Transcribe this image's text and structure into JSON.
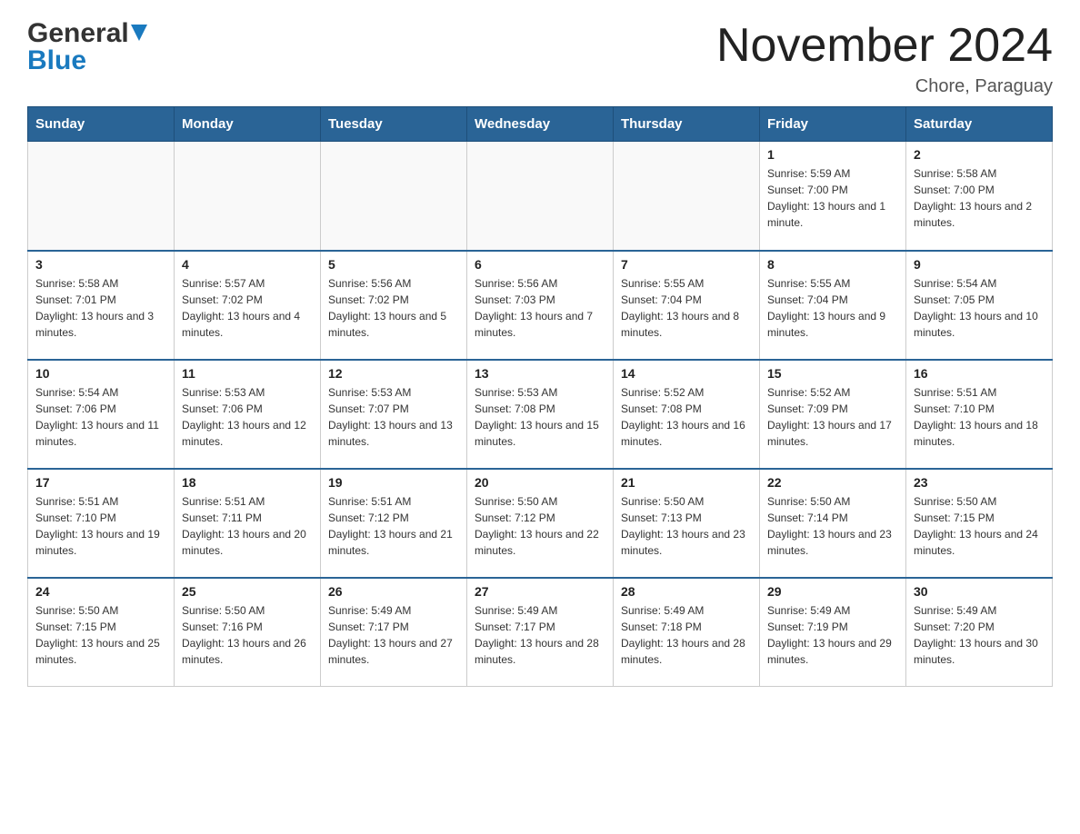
{
  "header": {
    "logo_general": "General",
    "logo_blue": "Blue",
    "month_title": "November 2024",
    "location": "Chore, Paraguay"
  },
  "days_of_week": [
    "Sunday",
    "Monday",
    "Tuesday",
    "Wednesday",
    "Thursday",
    "Friday",
    "Saturday"
  ],
  "weeks": [
    {
      "days": [
        {
          "number": "",
          "sunrise": "",
          "sunset": "",
          "daylight": ""
        },
        {
          "number": "",
          "sunrise": "",
          "sunset": "",
          "daylight": ""
        },
        {
          "number": "",
          "sunrise": "",
          "sunset": "",
          "daylight": ""
        },
        {
          "number": "",
          "sunrise": "",
          "sunset": "",
          "daylight": ""
        },
        {
          "number": "",
          "sunrise": "",
          "sunset": "",
          "daylight": ""
        },
        {
          "number": "1",
          "sunrise": "Sunrise: 5:59 AM",
          "sunset": "Sunset: 7:00 PM",
          "daylight": "Daylight: 13 hours and 1 minute."
        },
        {
          "number": "2",
          "sunrise": "Sunrise: 5:58 AM",
          "sunset": "Sunset: 7:00 PM",
          "daylight": "Daylight: 13 hours and 2 minutes."
        }
      ]
    },
    {
      "days": [
        {
          "number": "3",
          "sunrise": "Sunrise: 5:58 AM",
          "sunset": "Sunset: 7:01 PM",
          "daylight": "Daylight: 13 hours and 3 minutes."
        },
        {
          "number": "4",
          "sunrise": "Sunrise: 5:57 AM",
          "sunset": "Sunset: 7:02 PM",
          "daylight": "Daylight: 13 hours and 4 minutes."
        },
        {
          "number": "5",
          "sunrise": "Sunrise: 5:56 AM",
          "sunset": "Sunset: 7:02 PM",
          "daylight": "Daylight: 13 hours and 5 minutes."
        },
        {
          "number": "6",
          "sunrise": "Sunrise: 5:56 AM",
          "sunset": "Sunset: 7:03 PM",
          "daylight": "Daylight: 13 hours and 7 minutes."
        },
        {
          "number": "7",
          "sunrise": "Sunrise: 5:55 AM",
          "sunset": "Sunset: 7:04 PM",
          "daylight": "Daylight: 13 hours and 8 minutes."
        },
        {
          "number": "8",
          "sunrise": "Sunrise: 5:55 AM",
          "sunset": "Sunset: 7:04 PM",
          "daylight": "Daylight: 13 hours and 9 minutes."
        },
        {
          "number": "9",
          "sunrise": "Sunrise: 5:54 AM",
          "sunset": "Sunset: 7:05 PM",
          "daylight": "Daylight: 13 hours and 10 minutes."
        }
      ]
    },
    {
      "days": [
        {
          "number": "10",
          "sunrise": "Sunrise: 5:54 AM",
          "sunset": "Sunset: 7:06 PM",
          "daylight": "Daylight: 13 hours and 11 minutes."
        },
        {
          "number": "11",
          "sunrise": "Sunrise: 5:53 AM",
          "sunset": "Sunset: 7:06 PM",
          "daylight": "Daylight: 13 hours and 12 minutes."
        },
        {
          "number": "12",
          "sunrise": "Sunrise: 5:53 AM",
          "sunset": "Sunset: 7:07 PM",
          "daylight": "Daylight: 13 hours and 13 minutes."
        },
        {
          "number": "13",
          "sunrise": "Sunrise: 5:53 AM",
          "sunset": "Sunset: 7:08 PM",
          "daylight": "Daylight: 13 hours and 15 minutes."
        },
        {
          "number": "14",
          "sunrise": "Sunrise: 5:52 AM",
          "sunset": "Sunset: 7:08 PM",
          "daylight": "Daylight: 13 hours and 16 minutes."
        },
        {
          "number": "15",
          "sunrise": "Sunrise: 5:52 AM",
          "sunset": "Sunset: 7:09 PM",
          "daylight": "Daylight: 13 hours and 17 minutes."
        },
        {
          "number": "16",
          "sunrise": "Sunrise: 5:51 AM",
          "sunset": "Sunset: 7:10 PM",
          "daylight": "Daylight: 13 hours and 18 minutes."
        }
      ]
    },
    {
      "days": [
        {
          "number": "17",
          "sunrise": "Sunrise: 5:51 AM",
          "sunset": "Sunset: 7:10 PM",
          "daylight": "Daylight: 13 hours and 19 minutes."
        },
        {
          "number": "18",
          "sunrise": "Sunrise: 5:51 AM",
          "sunset": "Sunset: 7:11 PM",
          "daylight": "Daylight: 13 hours and 20 minutes."
        },
        {
          "number": "19",
          "sunrise": "Sunrise: 5:51 AM",
          "sunset": "Sunset: 7:12 PM",
          "daylight": "Daylight: 13 hours and 21 minutes."
        },
        {
          "number": "20",
          "sunrise": "Sunrise: 5:50 AM",
          "sunset": "Sunset: 7:12 PM",
          "daylight": "Daylight: 13 hours and 22 minutes."
        },
        {
          "number": "21",
          "sunrise": "Sunrise: 5:50 AM",
          "sunset": "Sunset: 7:13 PM",
          "daylight": "Daylight: 13 hours and 23 minutes."
        },
        {
          "number": "22",
          "sunrise": "Sunrise: 5:50 AM",
          "sunset": "Sunset: 7:14 PM",
          "daylight": "Daylight: 13 hours and 23 minutes."
        },
        {
          "number": "23",
          "sunrise": "Sunrise: 5:50 AM",
          "sunset": "Sunset: 7:15 PM",
          "daylight": "Daylight: 13 hours and 24 minutes."
        }
      ]
    },
    {
      "days": [
        {
          "number": "24",
          "sunrise": "Sunrise: 5:50 AM",
          "sunset": "Sunset: 7:15 PM",
          "daylight": "Daylight: 13 hours and 25 minutes."
        },
        {
          "number": "25",
          "sunrise": "Sunrise: 5:50 AM",
          "sunset": "Sunset: 7:16 PM",
          "daylight": "Daylight: 13 hours and 26 minutes."
        },
        {
          "number": "26",
          "sunrise": "Sunrise: 5:49 AM",
          "sunset": "Sunset: 7:17 PM",
          "daylight": "Daylight: 13 hours and 27 minutes."
        },
        {
          "number": "27",
          "sunrise": "Sunrise: 5:49 AM",
          "sunset": "Sunset: 7:17 PM",
          "daylight": "Daylight: 13 hours and 28 minutes."
        },
        {
          "number": "28",
          "sunrise": "Sunrise: 5:49 AM",
          "sunset": "Sunset: 7:18 PM",
          "daylight": "Daylight: 13 hours and 28 minutes."
        },
        {
          "number": "29",
          "sunrise": "Sunrise: 5:49 AM",
          "sunset": "Sunset: 7:19 PM",
          "daylight": "Daylight: 13 hours and 29 minutes."
        },
        {
          "number": "30",
          "sunrise": "Sunrise: 5:49 AM",
          "sunset": "Sunset: 7:20 PM",
          "daylight": "Daylight: 13 hours and 30 minutes."
        }
      ]
    }
  ]
}
